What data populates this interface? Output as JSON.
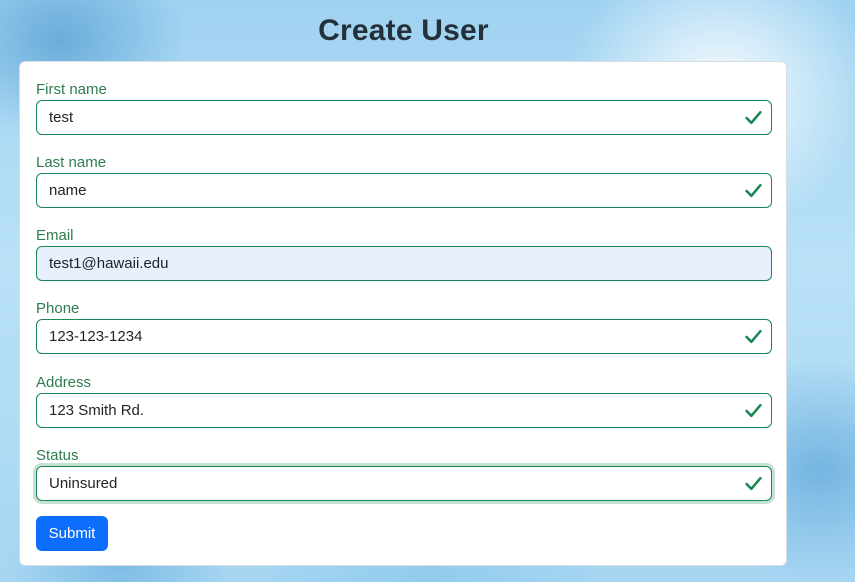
{
  "page": {
    "title": "Create User"
  },
  "form": {
    "fields": [
      {
        "label": "First name",
        "value": "test",
        "valid": true
      },
      {
        "label": "Last name",
        "value": "name",
        "valid": true
      },
      {
        "label": "Email",
        "value": "test1@hawaii.edu",
        "valid": false
      },
      {
        "label": "Phone",
        "value": "123-123-1234",
        "valid": true
      },
      {
        "label": "Address",
        "value": "123 Smith Rd.",
        "valid": true
      },
      {
        "label": "Status",
        "value": "Uninsured",
        "valid": true
      }
    ],
    "submit_label": "Submit"
  },
  "colors": {
    "valid": "#198754",
    "label": "#2e7d4f",
    "primary": "#0d6efd",
    "autofill_bg": "#e8f0fe"
  },
  "icons": {
    "valid": "check-icon"
  }
}
